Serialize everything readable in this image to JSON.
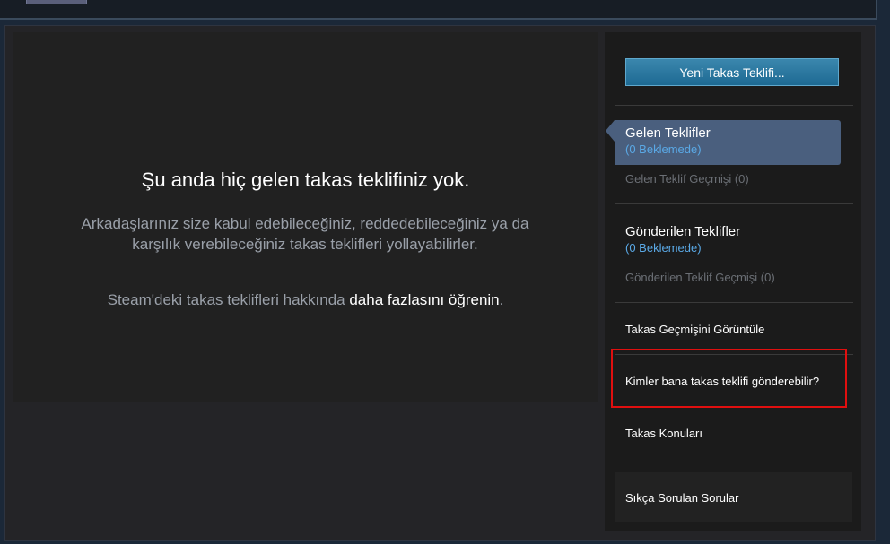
{
  "main": {
    "empty_title": "Şu anda hiç gelen takas teklifiniz yok.",
    "empty_body": "Arkadaşlarınız size kabul edebileceğiniz, reddedebileceğiniz ya da karşılık verebileceğiniz takas teklifleri yollayabilirler.",
    "learn_prefix": "Steam'deki takas teklifleri hakkında ",
    "learn_link": "daha fazlasını öğrenin",
    "learn_suffix": "."
  },
  "sidebar": {
    "new_offer_button": "Yeni Takas Teklifi...",
    "incoming": {
      "title": "Gelen Teklifler",
      "pending": "(0 Beklemede)",
      "history": "Gelen Teklif Geçmişi (0)"
    },
    "sent": {
      "title": "Gönderilen Teklifler",
      "pending": "(0 Beklemede)",
      "history": "Gönderilen Teklif Geçmişi (0)"
    },
    "links": {
      "trade_history": "Takas Geçmişini Görüntüle",
      "who_can_send": "Kimler bana takas teklifi gönderebilir?",
      "trade_topics": "Takas Konuları",
      "faq": "Sıkça Sorulan Sorular"
    }
  },
  "colors": {
    "highlight": "#e00f0f",
    "active_tab": "#4a5f7e",
    "accent_blue": "#5aa9e6"
  }
}
